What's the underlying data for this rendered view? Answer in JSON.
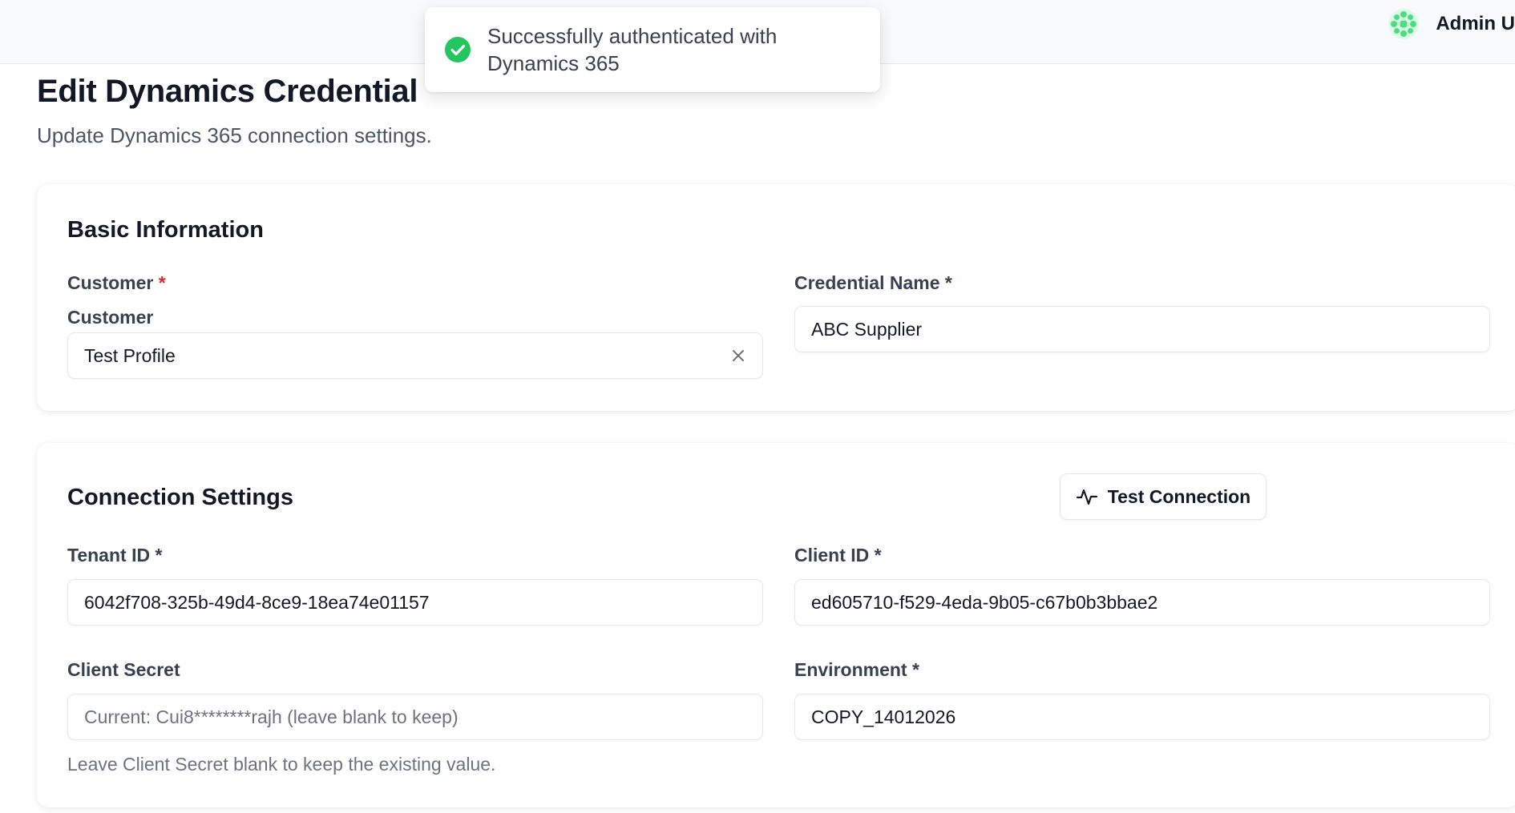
{
  "header": {
    "user_name": "Admin U",
    "avatar_icon": "green-snowflake-avatar-icon"
  },
  "toast": {
    "icon": "check-circle-icon",
    "line1": "Successfully authenticated with",
    "line2": "Dynamics 365",
    "accent": "#22c55e"
  },
  "page": {
    "title": "Edit Dynamics Credential",
    "subtitle": "Update Dynamics 365 connection settings."
  },
  "basic_info": {
    "title": "Basic Information",
    "customer_label": "Customer",
    "customer_required": "*",
    "customer_sub_label": "Customer",
    "customer_value": "Test Profile",
    "credential_name_label": "Credential Name *",
    "credential_name_value": "ABC Supplier"
  },
  "connection": {
    "title": "Connection Settings",
    "test_button_label": "Test Connection",
    "tenant_id_label": "Tenant ID *",
    "tenant_id_value": "6042f708-325b-49d4-8ce9-18ea74e01157",
    "client_id_label": "Client ID *",
    "client_id_value": "ed605710-f529-4eda-9b05-c67b0b3bbae2",
    "client_secret_label": "Client Secret",
    "client_secret_placeholder": "Current: Cui8********rajh (leave blank to keep)",
    "client_secret_helper": "Leave Client Secret blank to keep the existing value.",
    "environment_label": "Environment *",
    "environment_value": "COPY_14012026"
  }
}
